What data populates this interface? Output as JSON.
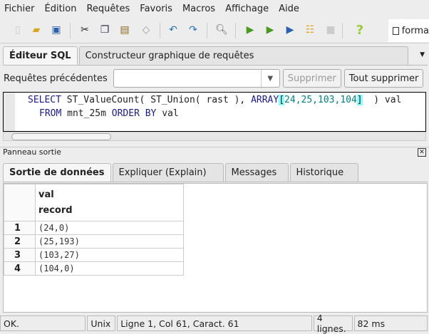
{
  "menu": [
    "Fichier",
    "Édition",
    "Requêtes",
    "Favoris",
    "Macros",
    "Affichage",
    "Aide"
  ],
  "toolbar": {
    "format_label": "forma"
  },
  "sql_tabs": [
    "Éditeur SQL",
    "Constructeur graphique de requêtes"
  ],
  "history": {
    "label": "Requêtes précédentes",
    "value": "",
    "clear": "Supprimer",
    "clear_all": "Tout supprimer"
  },
  "query": {
    "line1": {
      "kw1": "SELECT",
      "t1": " ST_ValueCount( ST_Union( rast ), ",
      "kw2": "ARRAY",
      "ob": "[",
      "nums": "24,25,103,104",
      "cb": "]",
      "t2": "  ) val"
    },
    "line2": {
      "kw1": "FROM",
      "t1": " mnt_25m ",
      "kw2": "ORDER BY",
      "t2": " val"
    }
  },
  "output": {
    "title": "Panneau sortie",
    "tabs": [
      "Sortie de données",
      "Expliquer (Explain)",
      "Messages",
      "Historique"
    ],
    "col_name": "val",
    "col_type": "record",
    "rows": [
      {
        "n": "1",
        "v": "(24,0)"
      },
      {
        "n": "2",
        "v": "(25,193)"
      },
      {
        "n": "3",
        "v": "(103,27)"
      },
      {
        "n": "4",
        "v": "(104,0)"
      }
    ]
  },
  "status": {
    "msg": "OK.",
    "eol": "Unix",
    "pos": "Ligne 1, Col 61, Caract. 61",
    "rows": "4 lignes.",
    "time": "82 ms"
  }
}
